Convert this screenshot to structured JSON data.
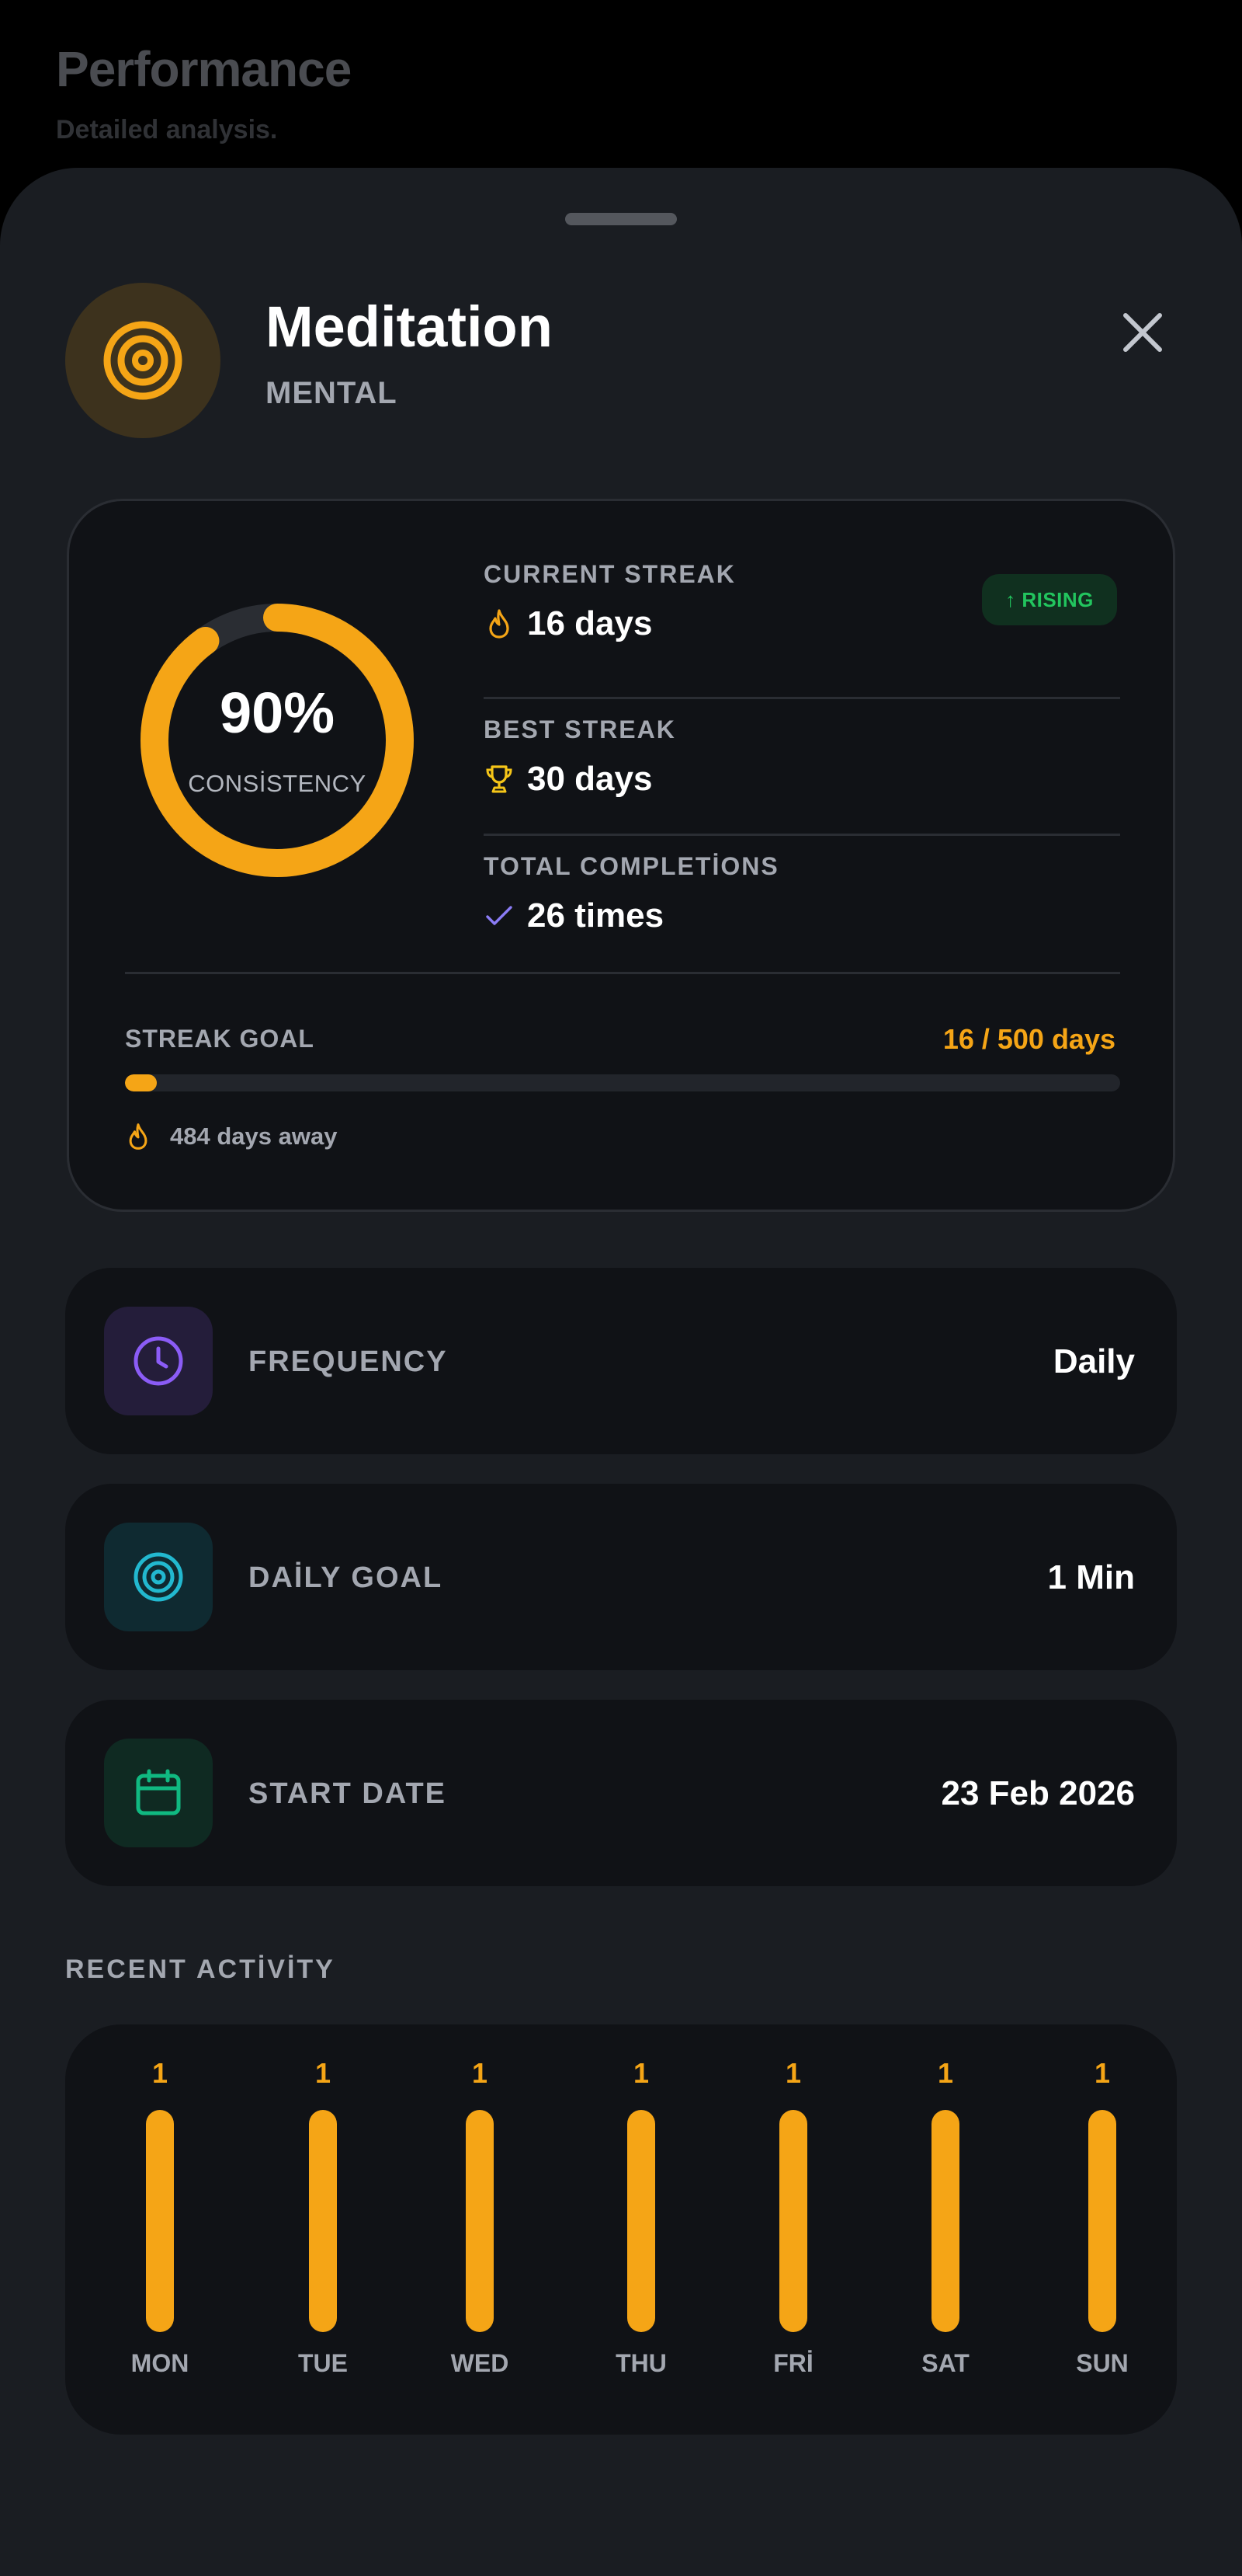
{
  "background": {
    "title": "Performance",
    "subtitle": "Detailed analysis."
  },
  "habit": {
    "name": "Meditation",
    "category": "MENTAL",
    "icon": "target-icon",
    "accent_color": "#f5a516"
  },
  "stats": {
    "consistency": {
      "percent": 90,
      "display": "90%",
      "label": "CONSİSTENCY"
    },
    "current_streak": {
      "label": "CURRENT STREAK",
      "value": "16 days",
      "icon": "flame-icon",
      "badge": "↑ RISING"
    },
    "best_streak": {
      "label": "BEST STREAK",
      "value": "30 days",
      "icon": "trophy-icon"
    },
    "total_completions": {
      "label": "TOTAL COMPLETİONS",
      "value": "26 times",
      "icon": "check-icon"
    },
    "streak_goal": {
      "label": "STREAK GOAL",
      "value": "16 / 500 days",
      "current": 16,
      "target": 500,
      "remaining": "484 days away"
    }
  },
  "details": [
    {
      "key": "frequency",
      "label": "FREQUENCY",
      "value": "Daily",
      "icon": "clock-icon",
      "color": "#8b5cf6",
      "bg": "#241d3a"
    },
    {
      "key": "daily-goal",
      "label": "DAİLY GOAL",
      "value": "1 Min",
      "icon": "target-icon",
      "color": "#22b8cf",
      "bg": "#0f2a31"
    },
    {
      "key": "start-date",
      "label": "START DATE",
      "value": "23 Feb 2026",
      "icon": "calendar-icon",
      "color": "#10b981",
      "bg": "#0f2a22"
    }
  ],
  "recent_activity": {
    "title": "RECENT ACTİVİTY",
    "days": [
      {
        "day": "MON",
        "count": "1"
      },
      {
        "day": "TUE",
        "count": "1"
      },
      {
        "day": "WED",
        "count": "1"
      },
      {
        "day": "THU",
        "count": "1"
      },
      {
        "day": "FRİ",
        "count": "1"
      },
      {
        "day": "SAT",
        "count": "1"
      },
      {
        "day": "SUN",
        "count": "1"
      }
    ]
  }
}
